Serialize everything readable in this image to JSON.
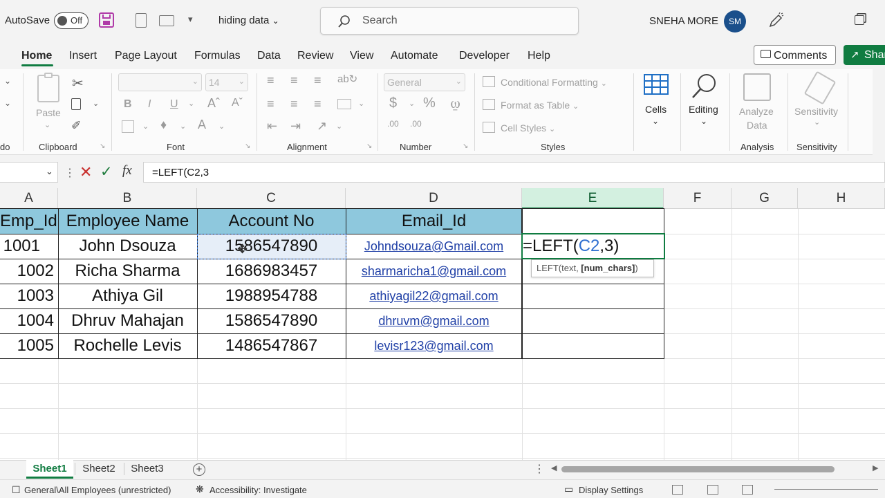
{
  "titlebar": {
    "autosave_label": "AutoSave",
    "autosave_state": "Off",
    "file_name": "hiding data",
    "search_placeholder": "Search",
    "user_name": "SNEHA MORE",
    "user_initials": "SM"
  },
  "tabs": [
    "Home",
    "Insert",
    "Page Layout",
    "Formulas",
    "Data",
    "Review",
    "View",
    "Automate",
    "Developer",
    "Help"
  ],
  "actions": {
    "comments": "Comments",
    "share": "Shar"
  },
  "ribbon": {
    "paste": "Paste",
    "clipboard": "Clipboard",
    "font": "Font",
    "font_size": "14",
    "bold": "B",
    "italic": "I",
    "underline": "U",
    "alignment": "Alignment",
    "number": "Number",
    "number_format": "General",
    "conditional_formatting": "Conditional Formatting",
    "format_as_table": "Format as Table",
    "cell_styles": "Cell Styles",
    "styles": "Styles",
    "cells": "Cells",
    "editing": "Editing",
    "analyze_data_1": "Analyze",
    "analyze_data_2": "Data",
    "analysis": "Analysis",
    "sensitivity_btn": "Sensitivity",
    "sensitivity": "Sensitivity",
    "undo_fragment": "do"
  },
  "formula_bar": {
    "fx": "fx",
    "value": "=LEFT(C2,3"
  },
  "columns": [
    "A",
    "B",
    "C",
    "D",
    "E",
    "F",
    "G",
    "H"
  ],
  "table": {
    "headers": [
      "Emp_Id",
      "Employee Name",
      "Account No",
      "Email_Id"
    ],
    "rows": [
      [
        "1001",
        "John Dsouza",
        "1586547890",
        "Johndsouza@Gmail.com"
      ],
      [
        "1002",
        "Richa Sharma",
        "1686983457",
        "sharmaricha1@gmail.com"
      ],
      [
        "1003",
        "Athiya Gil",
        "1988954788",
        "athiyagil22@gmail.com"
      ],
      [
        "1004",
        "Dhruv Mahajan",
        "1586547890",
        "dhruvm@gmail.com"
      ],
      [
        "1005",
        "Rochelle Levis",
        "1486547867",
        "levisr123@gmail.com"
      ]
    ]
  },
  "active_cell": {
    "prefix": "=LEFT(",
    "ref": "C2",
    "suffix": ",3)",
    "tooltip_func": "LEFT(text, ",
    "tooltip_arg": "[num_chars]",
    "tooltip_end": ")"
  },
  "sheets": [
    "Sheet1",
    "Sheet2",
    "Sheet3"
  ],
  "status": {
    "sensitivity_label": "General\\All Employees (unrestricted)",
    "accessibility": "Accessibility: Investigate",
    "display_settings": "Display Settings"
  },
  "colors": {
    "accent": "#107c41",
    "header_fill": "#8ec8dd",
    "link": "#1f3fa6",
    "ref": "#2f6fd0"
  }
}
